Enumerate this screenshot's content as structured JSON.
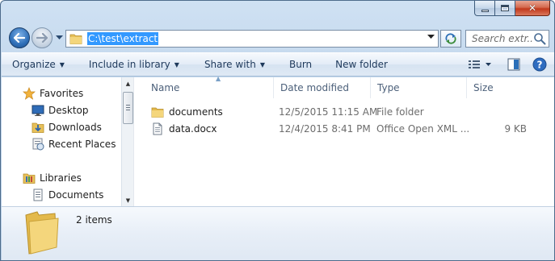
{
  "window": {
    "caption_buttons": {
      "minimize": "minimize",
      "maximize": "maximize",
      "close": "close"
    }
  },
  "nav": {
    "address": "C:\\test\\extract",
    "search_placeholder": "Search extr..."
  },
  "toolbar": {
    "organize": "Organize",
    "include_in_library": "Include in library",
    "share_with": "Share with",
    "burn": "Burn",
    "new_folder": "New folder"
  },
  "navpane": {
    "favorites_header": "Favorites",
    "favorites": [
      "Desktop",
      "Downloads",
      "Recent Places"
    ],
    "libraries_header": "Libraries",
    "libraries": [
      "Documents"
    ]
  },
  "columns": {
    "name": "Name",
    "date_modified": "Date modified",
    "type": "Type",
    "size": "Size"
  },
  "files": [
    {
      "name": "documents",
      "date": "12/5/2015 11:15 AM",
      "type": "File folder",
      "size": "",
      "icon": "folder-icon"
    },
    {
      "name": "data.docx",
      "date": "12/4/2015 8:41 PM",
      "type": "Office Open XML ...",
      "size": "9 KB",
      "icon": "document-icon"
    }
  ],
  "details": {
    "item_count": "2 items"
  },
  "colors": {
    "accent": "#3399ff",
    "chrome": "#bfd4ea",
    "toolbar_text": "#1e395b"
  }
}
